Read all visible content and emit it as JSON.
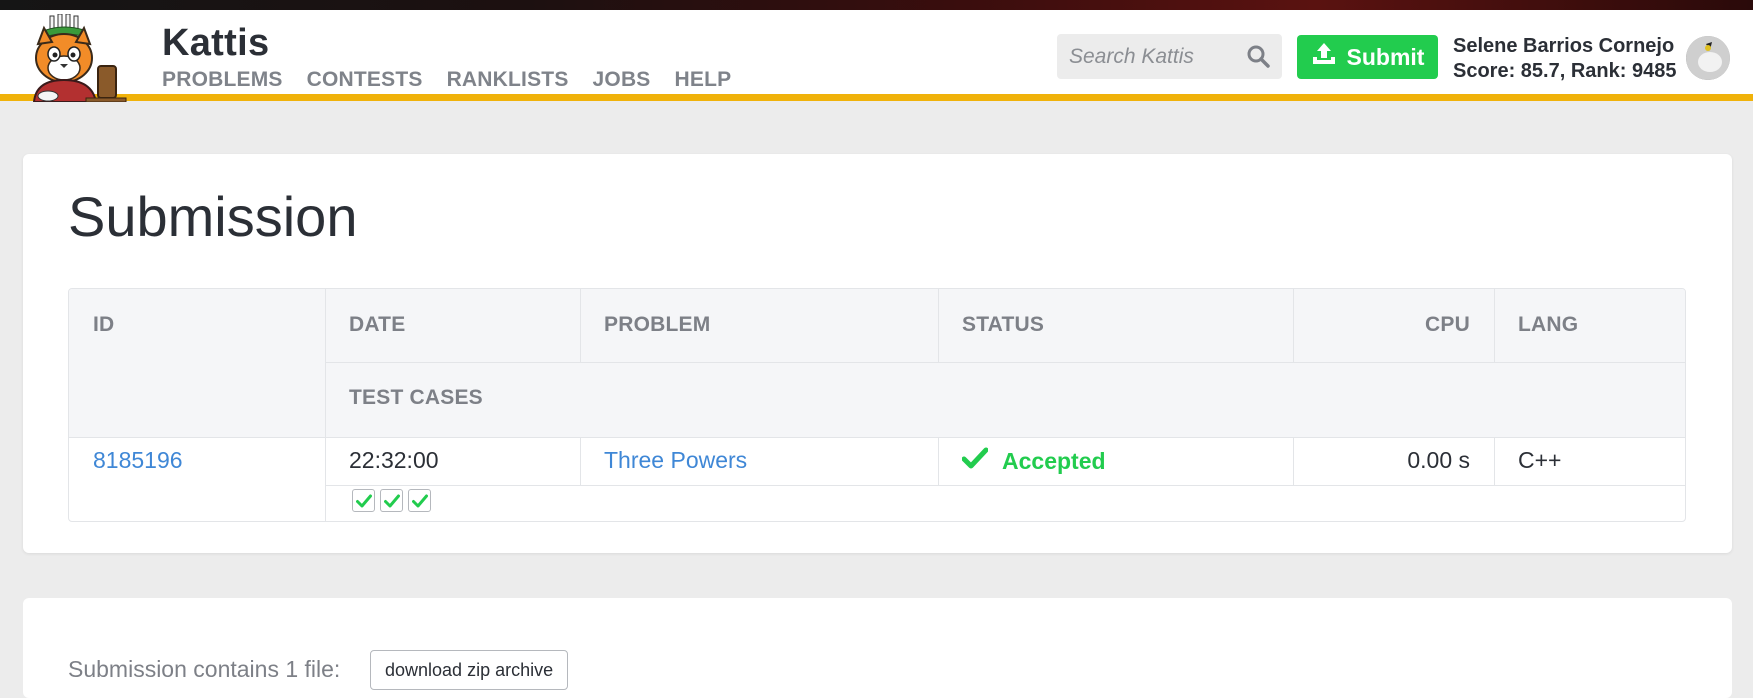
{
  "header": {
    "brand": "Kattis",
    "nav": [
      "PROBLEMS",
      "CONTESTS",
      "RANKLISTS",
      "JOBS",
      "HELP"
    ],
    "search_placeholder": "Search Kattis",
    "submit_label": "Submit",
    "user_name": "Selene Barrios Cornejo",
    "user_stats": "Score: 85.7, Rank: 9485"
  },
  "page_title": "Submission",
  "table": {
    "headers": {
      "id": "ID",
      "date": "DATE",
      "problem": "PROBLEM",
      "status": "STATUS",
      "cpu": "CPU",
      "lang": "LANG",
      "test_cases": "TEST CASES"
    },
    "row": {
      "id": "8185196",
      "date": "22:32:00",
      "problem": "Three Powers",
      "status": "Accepted",
      "cpu": "0.00 s",
      "lang": "C++",
      "test_cases_passed": 3
    }
  },
  "files": {
    "text": "Submission contains 1 file:",
    "download_label": "download zip archive"
  },
  "colors": {
    "accent": "#f0b20a",
    "success": "#22cc4e",
    "link": "#3f87d6"
  }
}
